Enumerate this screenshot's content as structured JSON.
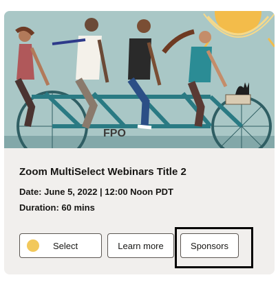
{
  "card": {
    "image_label": "FPO",
    "title": "Zoom MultiSelect Webinars Title 2",
    "date": "Date: June 5, 2022 | 12:00 Noon PDT",
    "duration": "Duration: 60 mins",
    "buttons": {
      "select": "Select",
      "learn_more": "Learn more",
      "sponsors": "Sponsors"
    }
  },
  "colors": {
    "card_background": "#f1efed",
    "hero_background": "#a9c7c6",
    "select_circle": "#f2c85b",
    "text": "#161513"
  }
}
